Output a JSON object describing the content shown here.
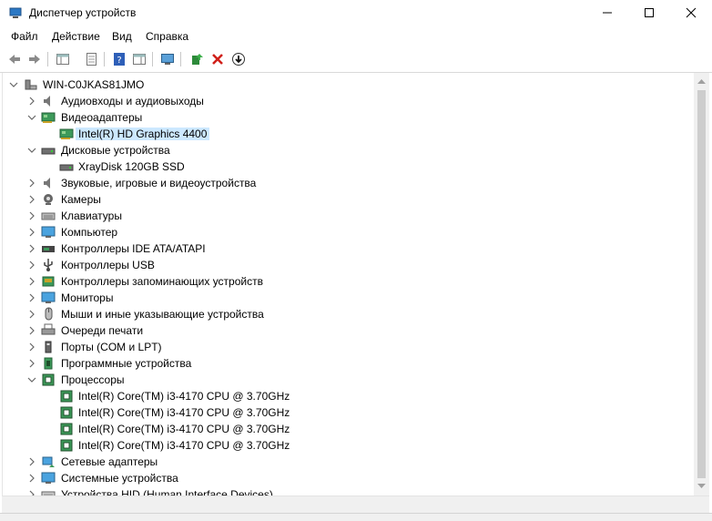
{
  "window": {
    "title": "Диспетчер устройств"
  },
  "menu": {
    "file": "Файл",
    "action": "Действие",
    "view": "Вид",
    "help": "Справка"
  },
  "tree": [
    {
      "label": "WIN-C0JKAS81JMO",
      "level": 0,
      "expander": "expanded",
      "icon": "computer-root-icon"
    },
    {
      "label": "Аудиовходы и аудиовыходы",
      "level": 1,
      "expander": "collapsed",
      "icon": "speaker-icon"
    },
    {
      "label": "Видеоадаптеры",
      "level": 1,
      "expander": "expanded",
      "icon": "display-adapter-icon"
    },
    {
      "label": "Intel(R) HD Graphics 4400",
      "level": 2,
      "expander": "none",
      "icon": "display-adapter-icon",
      "selected": true
    },
    {
      "label": "Дисковые устройства",
      "level": 1,
      "expander": "expanded",
      "icon": "disk-drive-icon"
    },
    {
      "label": "XrayDisk 120GB SSD",
      "level": 2,
      "expander": "none",
      "icon": "disk-drive-icon"
    },
    {
      "label": "Звуковые, игровые и видеоустройства",
      "level": 1,
      "expander": "collapsed",
      "icon": "speaker-icon"
    },
    {
      "label": "Камеры",
      "level": 1,
      "expander": "collapsed",
      "icon": "camera-icon"
    },
    {
      "label": "Клавиатуры",
      "level": 1,
      "expander": "collapsed",
      "icon": "keyboard-icon"
    },
    {
      "label": "Компьютер",
      "level": 1,
      "expander": "collapsed",
      "icon": "monitor-icon"
    },
    {
      "label": "Контроллеры IDE ATA/ATAPI",
      "level": 1,
      "expander": "collapsed",
      "icon": "ide-controller-icon"
    },
    {
      "label": "Контроллеры USB",
      "level": 1,
      "expander": "collapsed",
      "icon": "usb-icon"
    },
    {
      "label": "Контроллеры запоминающих устройств",
      "level": 1,
      "expander": "collapsed",
      "icon": "storage-controller-icon"
    },
    {
      "label": "Мониторы",
      "level": 1,
      "expander": "collapsed",
      "icon": "monitor-icon"
    },
    {
      "label": "Мыши и иные указывающие устройства",
      "level": 1,
      "expander": "collapsed",
      "icon": "mouse-icon"
    },
    {
      "label": "Очереди печати",
      "level": 1,
      "expander": "collapsed",
      "icon": "printer-icon"
    },
    {
      "label": "Порты (COM и LPT)",
      "level": 1,
      "expander": "collapsed",
      "icon": "port-icon"
    },
    {
      "label": "Программные устройства",
      "level": 1,
      "expander": "collapsed",
      "icon": "software-device-icon"
    },
    {
      "label": "Процессоры",
      "level": 1,
      "expander": "expanded",
      "icon": "processor-icon"
    },
    {
      "label": "Intel(R) Core(TM) i3-4170 CPU @ 3.70GHz",
      "level": 2,
      "expander": "none",
      "icon": "processor-icon"
    },
    {
      "label": "Intel(R) Core(TM) i3-4170 CPU @ 3.70GHz",
      "level": 2,
      "expander": "none",
      "icon": "processor-icon"
    },
    {
      "label": "Intel(R) Core(TM) i3-4170 CPU @ 3.70GHz",
      "level": 2,
      "expander": "none",
      "icon": "processor-icon"
    },
    {
      "label": "Intel(R) Core(TM) i3-4170 CPU @ 3.70GHz",
      "level": 2,
      "expander": "none",
      "icon": "processor-icon"
    },
    {
      "label": "Сетевые адаптеры",
      "level": 1,
      "expander": "collapsed",
      "icon": "network-adapter-icon"
    },
    {
      "label": "Системные устройства",
      "level": 1,
      "expander": "collapsed",
      "icon": "system-device-icon"
    },
    {
      "label": "Устройства HID (Human Interface Devices)",
      "level": 1,
      "expander": "collapsed",
      "icon": "hid-icon"
    }
  ],
  "colors": {
    "selection": "#cce8ff",
    "scrollbar_track": "#f0f0f0",
    "scrollbar_thumb": "#cdcdcd"
  }
}
